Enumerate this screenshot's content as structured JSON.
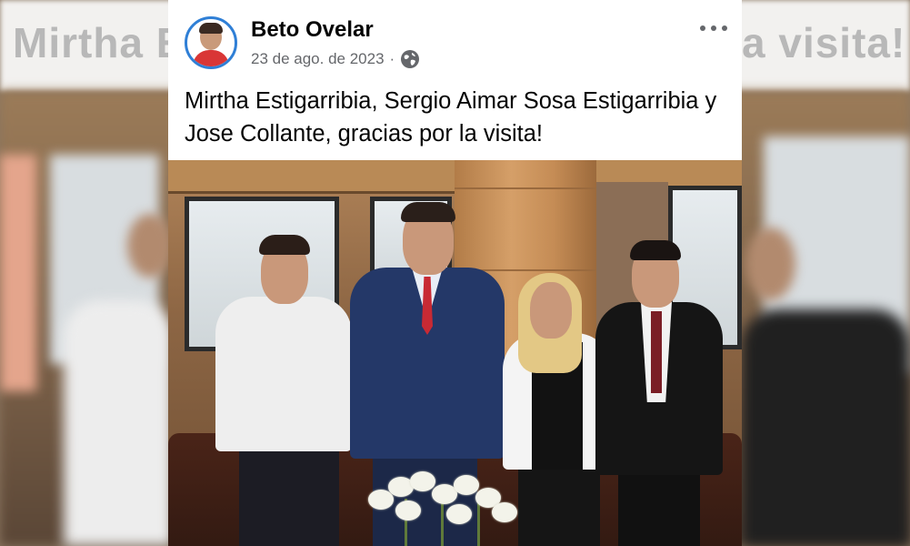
{
  "backdrop": {
    "top_left_text": "Mirtha E",
    "top_right_text": "a visita!",
    "bg_color": "#f2f1ef",
    "wall_color": "#8a6a4c"
  },
  "post": {
    "author_name": "Beto Ovelar",
    "date": "23 de ago. de 2023",
    "separator": "·",
    "privacy_icon": "globe-icon",
    "more_icon": "more-options-icon",
    "caption": "Mirtha Estigarribia, Sergio Aimar Sosa Estigarribia y Jose Collante, gracias por la visita!",
    "accent_color": "#2f7fd6"
  },
  "photo": {
    "description_icon": "group-photo",
    "colors": {
      "wall": "#a07350",
      "suit_navy": "#243868",
      "tie_red": "#c82a34",
      "sofa": "#3a1c14"
    }
  }
}
